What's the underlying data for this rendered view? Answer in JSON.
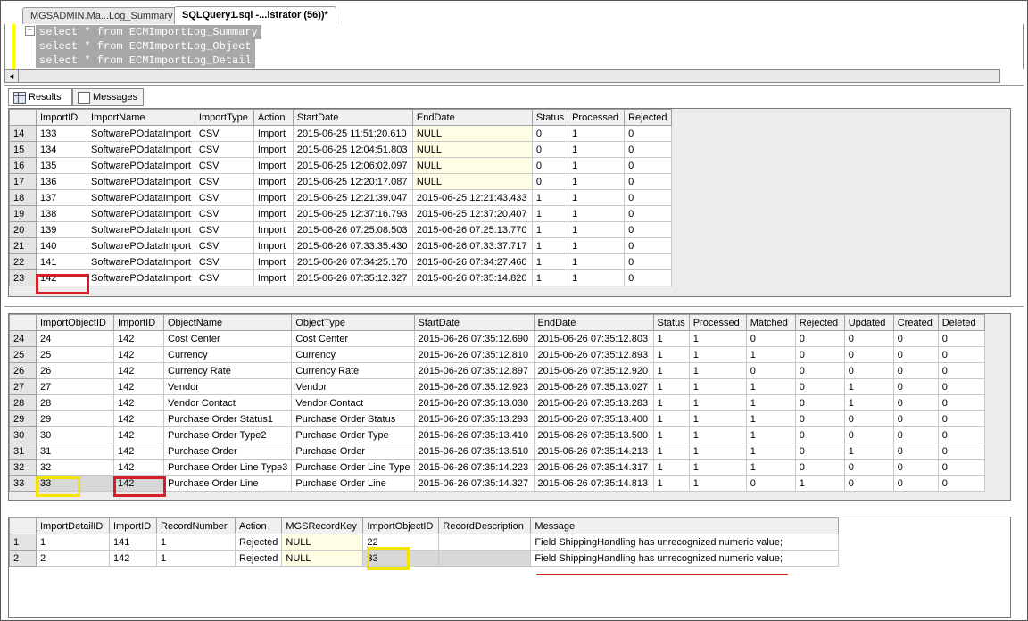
{
  "tabs": [
    {
      "label": "MGSADMIN.Ma...Log_Summary",
      "active": false
    },
    {
      "label": "SQLQuery1.sql -...istrator (56))*",
      "active": true
    }
  ],
  "editor": {
    "collapse_glyph": "−",
    "lines": [
      "select * from ECMImportLog_Summary",
      "select * from ECMImportLog_Object",
      "select * from ECMImportLog_Detail"
    ]
  },
  "scroll_left_glyph": "◂",
  "result_tabs": [
    {
      "label": "Results",
      "icon": "grid-icon",
      "active": true
    },
    {
      "label": "Messages",
      "icon": "messages-icon",
      "active": false
    }
  ],
  "summary": {
    "columns": [
      "",
      "ImportID",
      "ImportName",
      "ImportType",
      "Action",
      "StartDate",
      "EndDate",
      "Status",
      "Processed",
      "Rejected"
    ],
    "rows": [
      [
        "14",
        "133",
        "SoftwarePOdataImport",
        "CSV",
        "Import",
        "2015-06-25 11:51:20.610",
        "NULL",
        "0",
        "1",
        "0"
      ],
      [
        "15",
        "134",
        "SoftwarePOdataImport",
        "CSV",
        "Import",
        "2015-06-25 12:04:51.803",
        "NULL",
        "0",
        "1",
        "0"
      ],
      [
        "16",
        "135",
        "SoftwarePOdataImport",
        "CSV",
        "Import",
        "2015-06-25 12:06:02.097",
        "NULL",
        "0",
        "1",
        "0"
      ],
      [
        "17",
        "136",
        "SoftwarePOdataImport",
        "CSV",
        "Import",
        "2015-06-25 12:20:17.087",
        "NULL",
        "0",
        "1",
        "0"
      ],
      [
        "18",
        "137",
        "SoftwarePOdataImport",
        "CSV",
        "Import",
        "2015-06-25 12:21:39.047",
        "2015-06-25 12:21:43.433",
        "1",
        "1",
        "0"
      ],
      [
        "19",
        "138",
        "SoftwarePOdataImport",
        "CSV",
        "Import",
        "2015-06-25 12:37:16.793",
        "2015-06-25 12:37:20.407",
        "1",
        "1",
        "0"
      ],
      [
        "20",
        "139",
        "SoftwarePOdataImport",
        "CSV",
        "Import",
        "2015-06-26 07:25:08.503",
        "2015-06-26 07:25:13.770",
        "1",
        "1",
        "0"
      ],
      [
        "21",
        "140",
        "SoftwarePOdataImport",
        "CSV",
        "Import",
        "2015-06-26 07:33:35.430",
        "2015-06-26 07:33:37.717",
        "1",
        "1",
        "0"
      ],
      [
        "22",
        "141",
        "SoftwarePOdataImport",
        "CSV",
        "Import",
        "2015-06-26 07:34:25.170",
        "2015-06-26 07:34:27.460",
        "1",
        "1",
        "0"
      ],
      [
        "23",
        "142",
        "SoftwarePOdataImport",
        "CSV",
        "Import",
        "2015-06-26 07:35:12.327",
        "2015-06-26 07:35:14.820",
        "1",
        "1",
        "0"
      ]
    ]
  },
  "object": {
    "columns": [
      "",
      "ImportObjectID",
      "ImportID",
      "ObjectName",
      "ObjectType",
      "StartDate",
      "EndDate",
      "Status",
      "Processed",
      "Matched",
      "Rejected",
      "Updated",
      "Created",
      "Deleted"
    ],
    "rows": [
      [
        "24",
        "24",
        "142",
        "Cost Center",
        "Cost Center",
        "2015-06-26 07:35:12.690",
        "2015-06-26 07:35:12.803",
        "1",
        "1",
        "0",
        "0",
        "0",
        "0",
        "0"
      ],
      [
        "25",
        "25",
        "142",
        "Currency",
        "Currency",
        "2015-06-26 07:35:12.810",
        "2015-06-26 07:35:12.893",
        "1",
        "1",
        "1",
        "0",
        "0",
        "0",
        "0"
      ],
      [
        "26",
        "26",
        "142",
        "Currency Rate",
        "Currency Rate",
        "2015-06-26 07:35:12.897",
        "2015-06-26 07:35:12.920",
        "1",
        "1",
        "0",
        "0",
        "0",
        "0",
        "0"
      ],
      [
        "27",
        "27",
        "142",
        "Vendor",
        "Vendor",
        "2015-06-26 07:35:12.923",
        "2015-06-26 07:35:13.027",
        "1",
        "1",
        "1",
        "0",
        "1",
        "0",
        "0"
      ],
      [
        "28",
        "28",
        "142",
        "Vendor Contact",
        "Vendor Contact",
        "2015-06-26 07:35:13.030",
        "2015-06-26 07:35:13.283",
        "1",
        "1",
        "1",
        "0",
        "1",
        "0",
        "0"
      ],
      [
        "29",
        "29",
        "142",
        "Purchase Order Status1",
        "Purchase Order Status",
        "2015-06-26 07:35:13.293",
        "2015-06-26 07:35:13.400",
        "1",
        "1",
        "1",
        "0",
        "0",
        "0",
        "0"
      ],
      [
        "30",
        "30",
        "142",
        "Purchase Order Type2",
        "Purchase Order Type",
        "2015-06-26 07:35:13.410",
        "2015-06-26 07:35:13.500",
        "1",
        "1",
        "1",
        "0",
        "0",
        "0",
        "0"
      ],
      [
        "31",
        "31",
        "142",
        "Purchase Order",
        "Purchase Order",
        "2015-06-26 07:35:13.510",
        "2015-06-26 07:35:14.213",
        "1",
        "1",
        "1",
        "0",
        "1",
        "0",
        "0"
      ],
      [
        "32",
        "32",
        "142",
        "Purchase Order Line Type3",
        "Purchase Order Line Type",
        "2015-06-26 07:35:14.223",
        "2015-06-26 07:35:14.317",
        "1",
        "1",
        "1",
        "0",
        "0",
        "0",
        "0"
      ],
      [
        "33",
        "33",
        "142",
        "Purchase Order Line",
        "Purchase Order Line",
        "2015-06-26 07:35:14.327",
        "2015-06-26 07:35:14.813",
        "1",
        "1",
        "0",
        "1",
        "0",
        "0",
        "0"
      ]
    ]
  },
  "detail": {
    "columns": [
      "",
      "ImportDetailID",
      "ImportID",
      "RecordNumber",
      "Action",
      "MGSRecordKey",
      "ImportObjectID",
      "RecordDescription",
      "Message"
    ],
    "rows": [
      [
        "1",
        "1",
        "141",
        "1",
        "Rejected",
        "NULL",
        "22",
        "",
        "Field ShippingHandling has unrecognized numeric value;"
      ],
      [
        "2",
        "2",
        "142",
        "1",
        "Rejected",
        "NULL",
        "33",
        "",
        "Field ShippingHandling has unrecognized numeric value;"
      ]
    ]
  },
  "colors": {
    "highlight_red": "#d41f2a",
    "highlight_yellow": "#f2e600",
    "null_cell": "#fffde3"
  }
}
